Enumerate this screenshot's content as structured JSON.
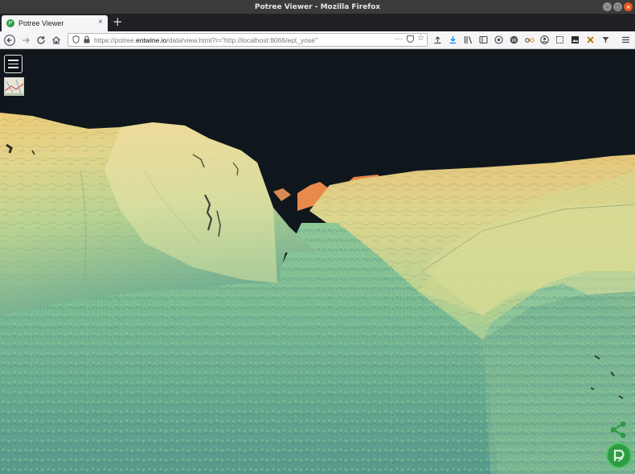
{
  "window": {
    "title": "Potree Viewer - Mozilla Firefox",
    "minimize_glyph": "–",
    "maximize_glyph": "□",
    "close_glyph": "×"
  },
  "tabs": [
    {
      "title": "Potree Viewer",
      "active": true
    }
  ],
  "tabstrip": {
    "new_tab_glyph": "+",
    "close_tab_glyph": "×"
  },
  "navbar": {
    "url_prefix": "https://potree.",
    "url_domain": "entwine.io",
    "url_path": "/data/view.html?r=\"http://localhost:8066/ept_yose\"",
    "page_actions_glyph": "···"
  },
  "viewer": {
    "sky_color": "#10171c",
    "terrain_colors": [
      "#e9c46a",
      "#d7d87e",
      "#a5cf8c",
      "#79b98f",
      "#5fa08a",
      "#f08a4b"
    ]
  },
  "icons": {
    "back": "back-arrow-icon",
    "forward": "forward-arrow-icon",
    "reload": "reload-icon",
    "home": "home-icon",
    "menu": "hamburger-menu-icon",
    "share": "share-icon",
    "logo": "potree-logo-icon"
  }
}
